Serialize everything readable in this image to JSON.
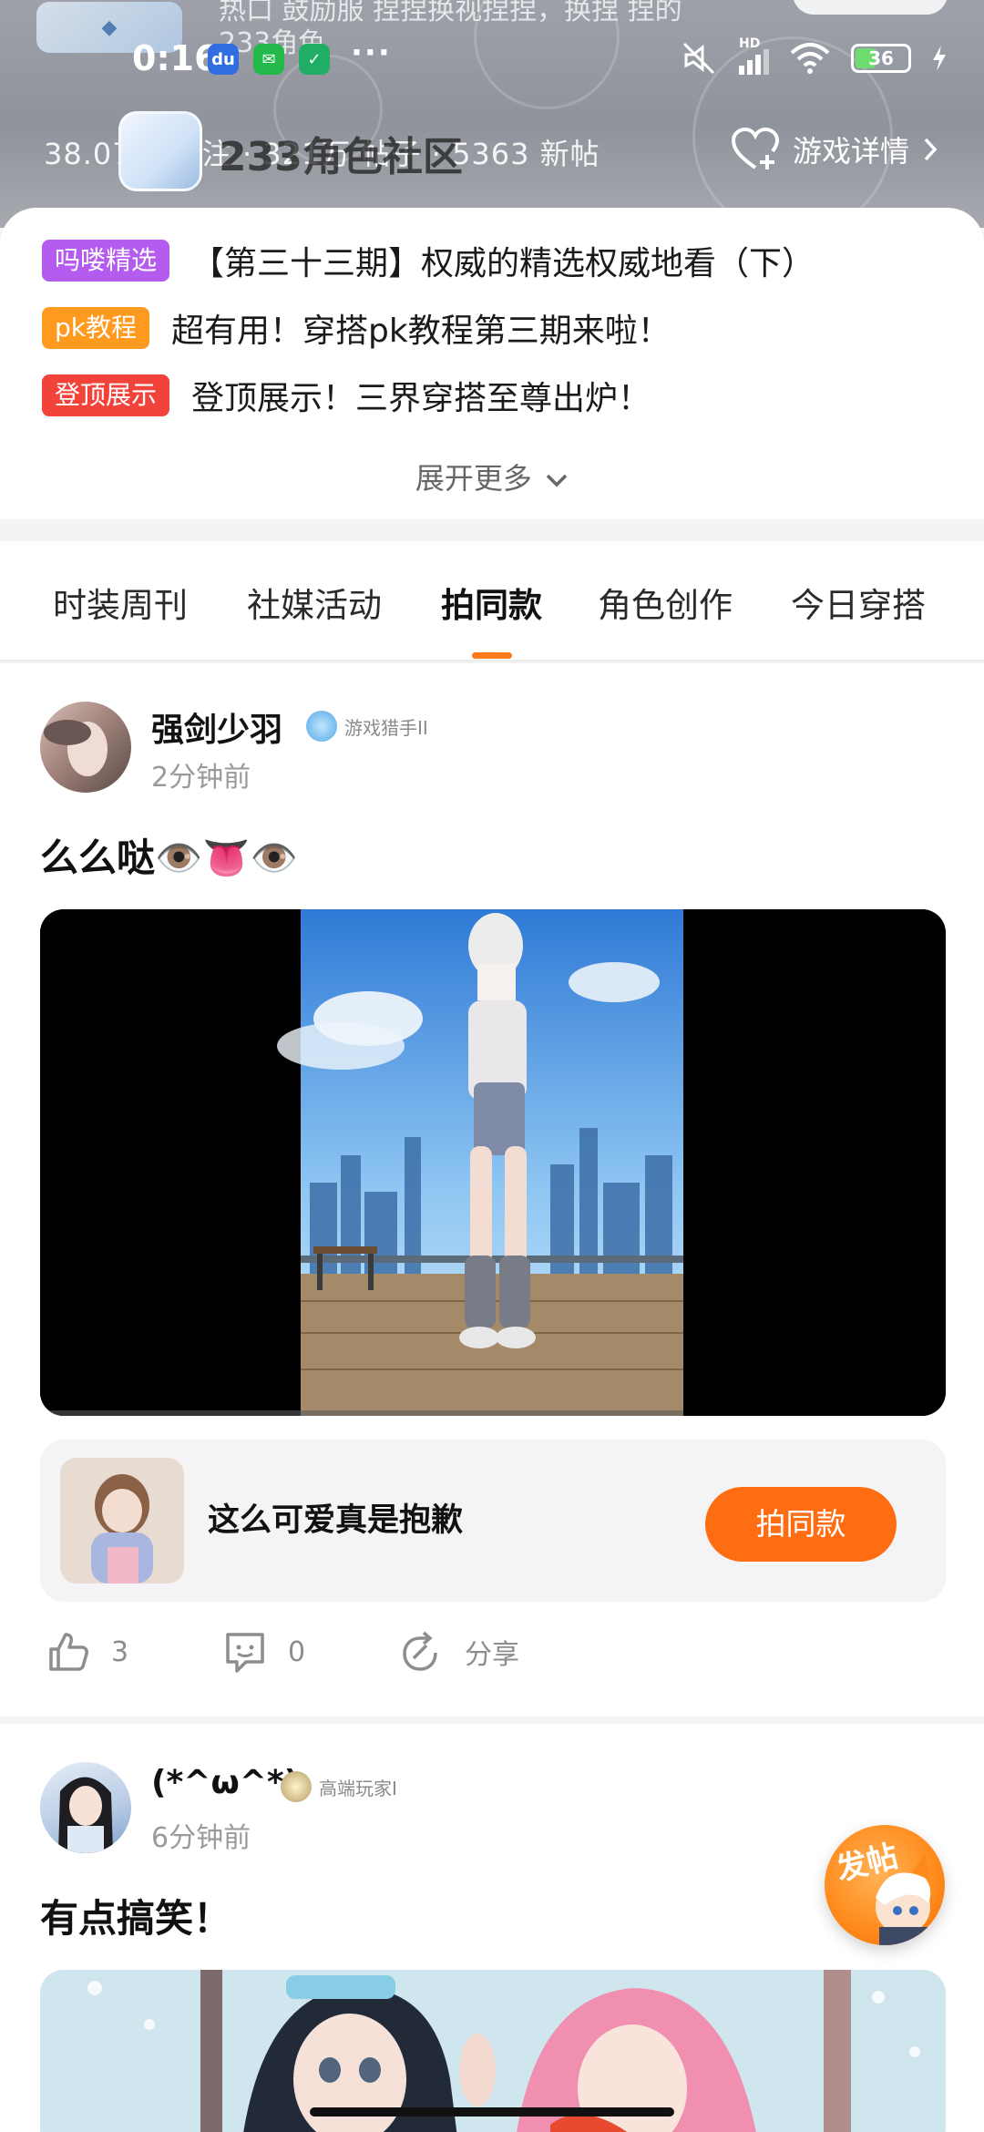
{
  "header": {
    "ghost_text_top": "热口 鼓励服 捏捏换视捏捏，换捏 捏的",
    "ghost_text_sub": "233角色",
    "stats": "38.07万 关注 · 321万 帖子 · 5363 新帖",
    "community_title": "233角色社区",
    "game_details_label": "游戏详情"
  },
  "statusbar": {
    "time": "0:16",
    "dots": "···",
    "network_label": "HD",
    "battery_level": "36"
  },
  "topics": [
    {
      "tag": "吗喽精选",
      "text": "【第三十三期】权威的精选权威地看（下）",
      "color": "#b45cf0"
    },
    {
      "tag": "pk教程",
      "text": "超有用！穿搭pk教程第三期来啦！",
      "color": "#ff9a1f"
    },
    {
      "tag": "登顶展示",
      "text": "登顶展示！三界穿搭至尊出炉！",
      "color": "#f2433b"
    }
  ],
  "expand_label": "展开更多",
  "tabs": [
    {
      "label": "时装周刊",
      "active": false
    },
    {
      "label": "社媒活动",
      "active": false
    },
    {
      "label": "拍同款",
      "active": true
    },
    {
      "label": "角色创作",
      "active": false
    },
    {
      "label": "今日穿搭",
      "active": false
    }
  ],
  "posts": [
    {
      "username": "强剑少羽",
      "badge": "游戏猎手II",
      "time": "2分钟前",
      "text": "么么哒👁️👅👁️",
      "same_card": {
        "title": "这么可爱真是抱歉",
        "button": "拍同款"
      },
      "likes": "3",
      "comments": "0",
      "share_label": "分享"
    },
    {
      "username": "(*^ω^*)",
      "badge": "高端玩家I",
      "time": "6分钟前",
      "text": "有点搞笑！"
    }
  ],
  "fab_label": "发帖",
  "colors": {
    "accent": "#ff6d12",
    "tab_underline": "#ff7a1a"
  }
}
